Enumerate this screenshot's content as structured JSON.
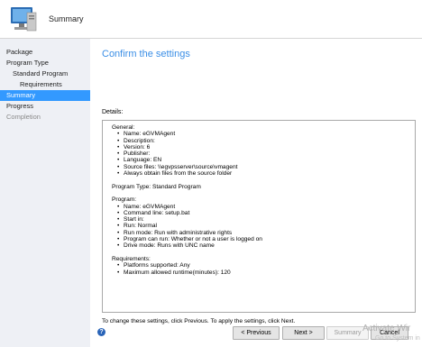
{
  "header": {
    "title": "Summary",
    "icon": "computer-wizard-icon"
  },
  "sidebar": {
    "items": [
      {
        "label": "Package"
      },
      {
        "label": "Program Type"
      },
      {
        "label": "Standard Program"
      },
      {
        "label": "Requirements"
      },
      {
        "label": "Summary"
      },
      {
        "label": "Progress"
      },
      {
        "label": "Completion"
      }
    ],
    "selected_color": "#3399ff"
  },
  "main": {
    "title": "Confirm the settings",
    "details_label": "Details:",
    "details": {
      "general_head": "General:",
      "general": [
        "Name: eGVMAgent",
        "Description:",
        "Version: 6",
        "Publisher:",
        "Language: EN",
        "Source files: \\\\egvpsserver\\source\\vmagent",
        "Always obtain files from the source folder"
      ],
      "program_type": "Program Type: Standard Program",
      "program_head": "Program:",
      "program": [
        "Name: eGVMAgent",
        "Command line: setup.bat",
        "Start in:",
        "Run: Normal",
        "Run mode: Run with administrative rights",
        "Program can run: Whether or not a user is logged on",
        "Drive mode: Runs with UNC name"
      ],
      "requirements_head": "Requirements:",
      "requirements": [
        "Platforms supported: Any",
        "Maximum allowed runtime(minutes): 120"
      ]
    },
    "hint": "To change these settings, click Previous. To apply the settings, click Next."
  },
  "footer": {
    "help_glyph": "?",
    "previous": "< Previous",
    "next": "Next >",
    "summary": "Summary",
    "cancel": "Cancel"
  },
  "watermark": {
    "line1": "Activate Wir",
    "line2": "Go to System in"
  },
  "colors": {
    "accent": "#3a8ee6",
    "sidebar_bg": "#eef0f5"
  }
}
